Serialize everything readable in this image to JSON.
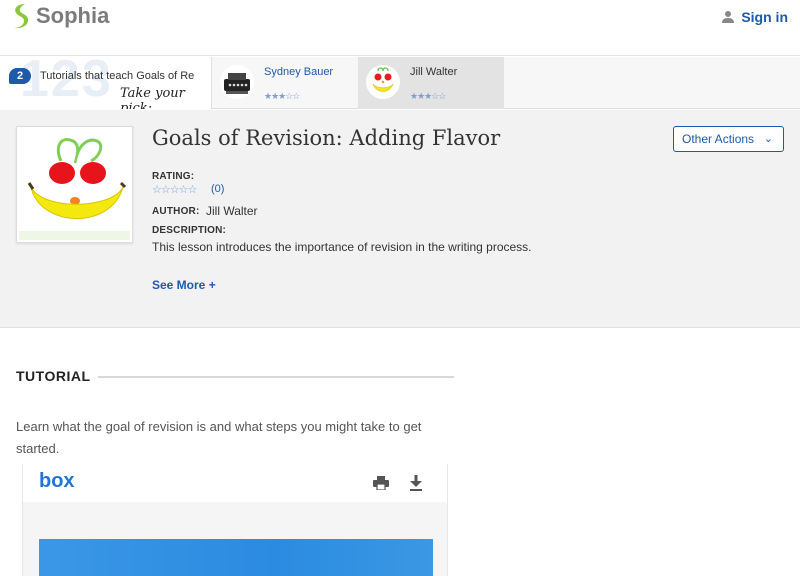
{
  "header": {
    "logo_text": "Sophia",
    "signin_label": "Sign in"
  },
  "strip": {
    "count": "2",
    "title": "Tutorials that teach Goals of Re",
    "pick_label": "Take your pick:",
    "cards": [
      {
        "name": "Sydney Bauer",
        "stars": "★★★☆☆"
      },
      {
        "name": "Jill Walter",
        "stars": "★★★☆☆"
      }
    ]
  },
  "lesson": {
    "title": "Goals of Revision: Adding Flavor",
    "other_actions_label": "Other Actions",
    "rating_label": "RATING:",
    "rating_stars": "☆☆☆☆☆",
    "rating_count": "(0)",
    "author_label": "AUTHOR:",
    "author_name": "Jill Walter",
    "description_label": "DESCRIPTION:",
    "description": "This lesson introduces the importance of revision in the writing process.",
    "see_more_label": "See More +"
  },
  "tutorial": {
    "heading": "TUTORIAL",
    "description": "Learn what the goal of revision is and what steps you might take to get started."
  },
  "box_viewer": {
    "logo": "box"
  },
  "colors": {
    "brand_green": "#8cc63f",
    "link_blue": "#1e5aa8",
    "box_blue": "#1f76d2"
  }
}
